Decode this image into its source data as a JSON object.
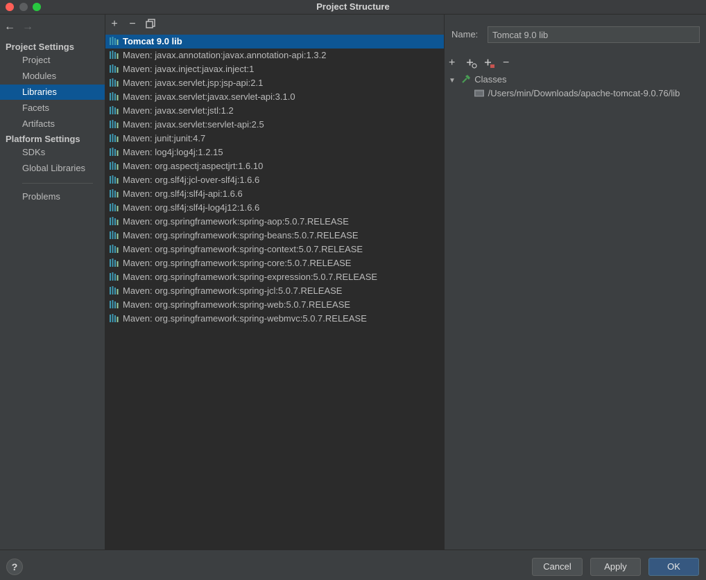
{
  "window": {
    "title": "Project Structure"
  },
  "sidebar": {
    "back_icon": "arrow-left-icon",
    "forward_icon": "arrow-right-icon",
    "project_settings_label": "Project Settings",
    "project_items": [
      "Project",
      "Modules",
      "Libraries",
      "Facets",
      "Artifacts"
    ],
    "platform_settings_label": "Platform Settings",
    "platform_items": [
      "SDKs",
      "Global Libraries"
    ],
    "problems_label": "Problems",
    "selected": "Libraries"
  },
  "libraries": {
    "toolbar": [
      "add-icon",
      "remove-icon",
      "copy-icon"
    ],
    "items": [
      "Tomcat 9.0 lib",
      "Maven: javax.annotation:javax.annotation-api:1.3.2",
      "Maven: javax.inject:javax.inject:1",
      "Maven: javax.servlet.jsp:jsp-api:2.1",
      "Maven: javax.servlet:javax.servlet-api:3.1.0",
      "Maven: javax.servlet:jstl:1.2",
      "Maven: javax.servlet:servlet-api:2.5",
      "Maven: junit:junit:4.7",
      "Maven: log4j:log4j:1.2.15",
      "Maven: org.aspectj:aspectjrt:1.6.10",
      "Maven: org.slf4j:jcl-over-slf4j:1.6.6",
      "Maven: org.slf4j:slf4j-api:1.6.6",
      "Maven: org.slf4j:slf4j-log4j12:1.6.6",
      "Maven: org.springframework:spring-aop:5.0.7.RELEASE",
      "Maven: org.springframework:spring-beans:5.0.7.RELEASE",
      "Maven: org.springframework:spring-context:5.0.7.RELEASE",
      "Maven: org.springframework:spring-core:5.0.7.RELEASE",
      "Maven: org.springframework:spring-expression:5.0.7.RELEASE",
      "Maven: org.springframework:spring-jcl:5.0.7.RELEASE",
      "Maven: org.springframework:spring-web:5.0.7.RELEASE",
      "Maven: org.springframework:spring-webmvc:5.0.7.RELEASE"
    ],
    "selected_index": 0
  },
  "detail": {
    "name_label": "Name:",
    "name_value": "Tomcat 9.0 lib",
    "toolbar": [
      "add-icon",
      "add-url-icon",
      "add-jar-icon",
      "remove-icon"
    ],
    "tree": {
      "root_label": "Classes",
      "root_icon": "hammer-icon",
      "children": [
        "/Users/min/Downloads/apache-tomcat-9.0.76/lib"
      ]
    }
  },
  "footer": {
    "help_label": "?",
    "cancel_label": "Cancel",
    "apply_label": "Apply",
    "ok_label": "OK"
  },
  "colors": {
    "selection": "#0d5694",
    "background": "#3c3f41",
    "list_background": "#2b2b2b",
    "ok_button": "#365880",
    "library_icon_bars": "#3e9ab3"
  }
}
